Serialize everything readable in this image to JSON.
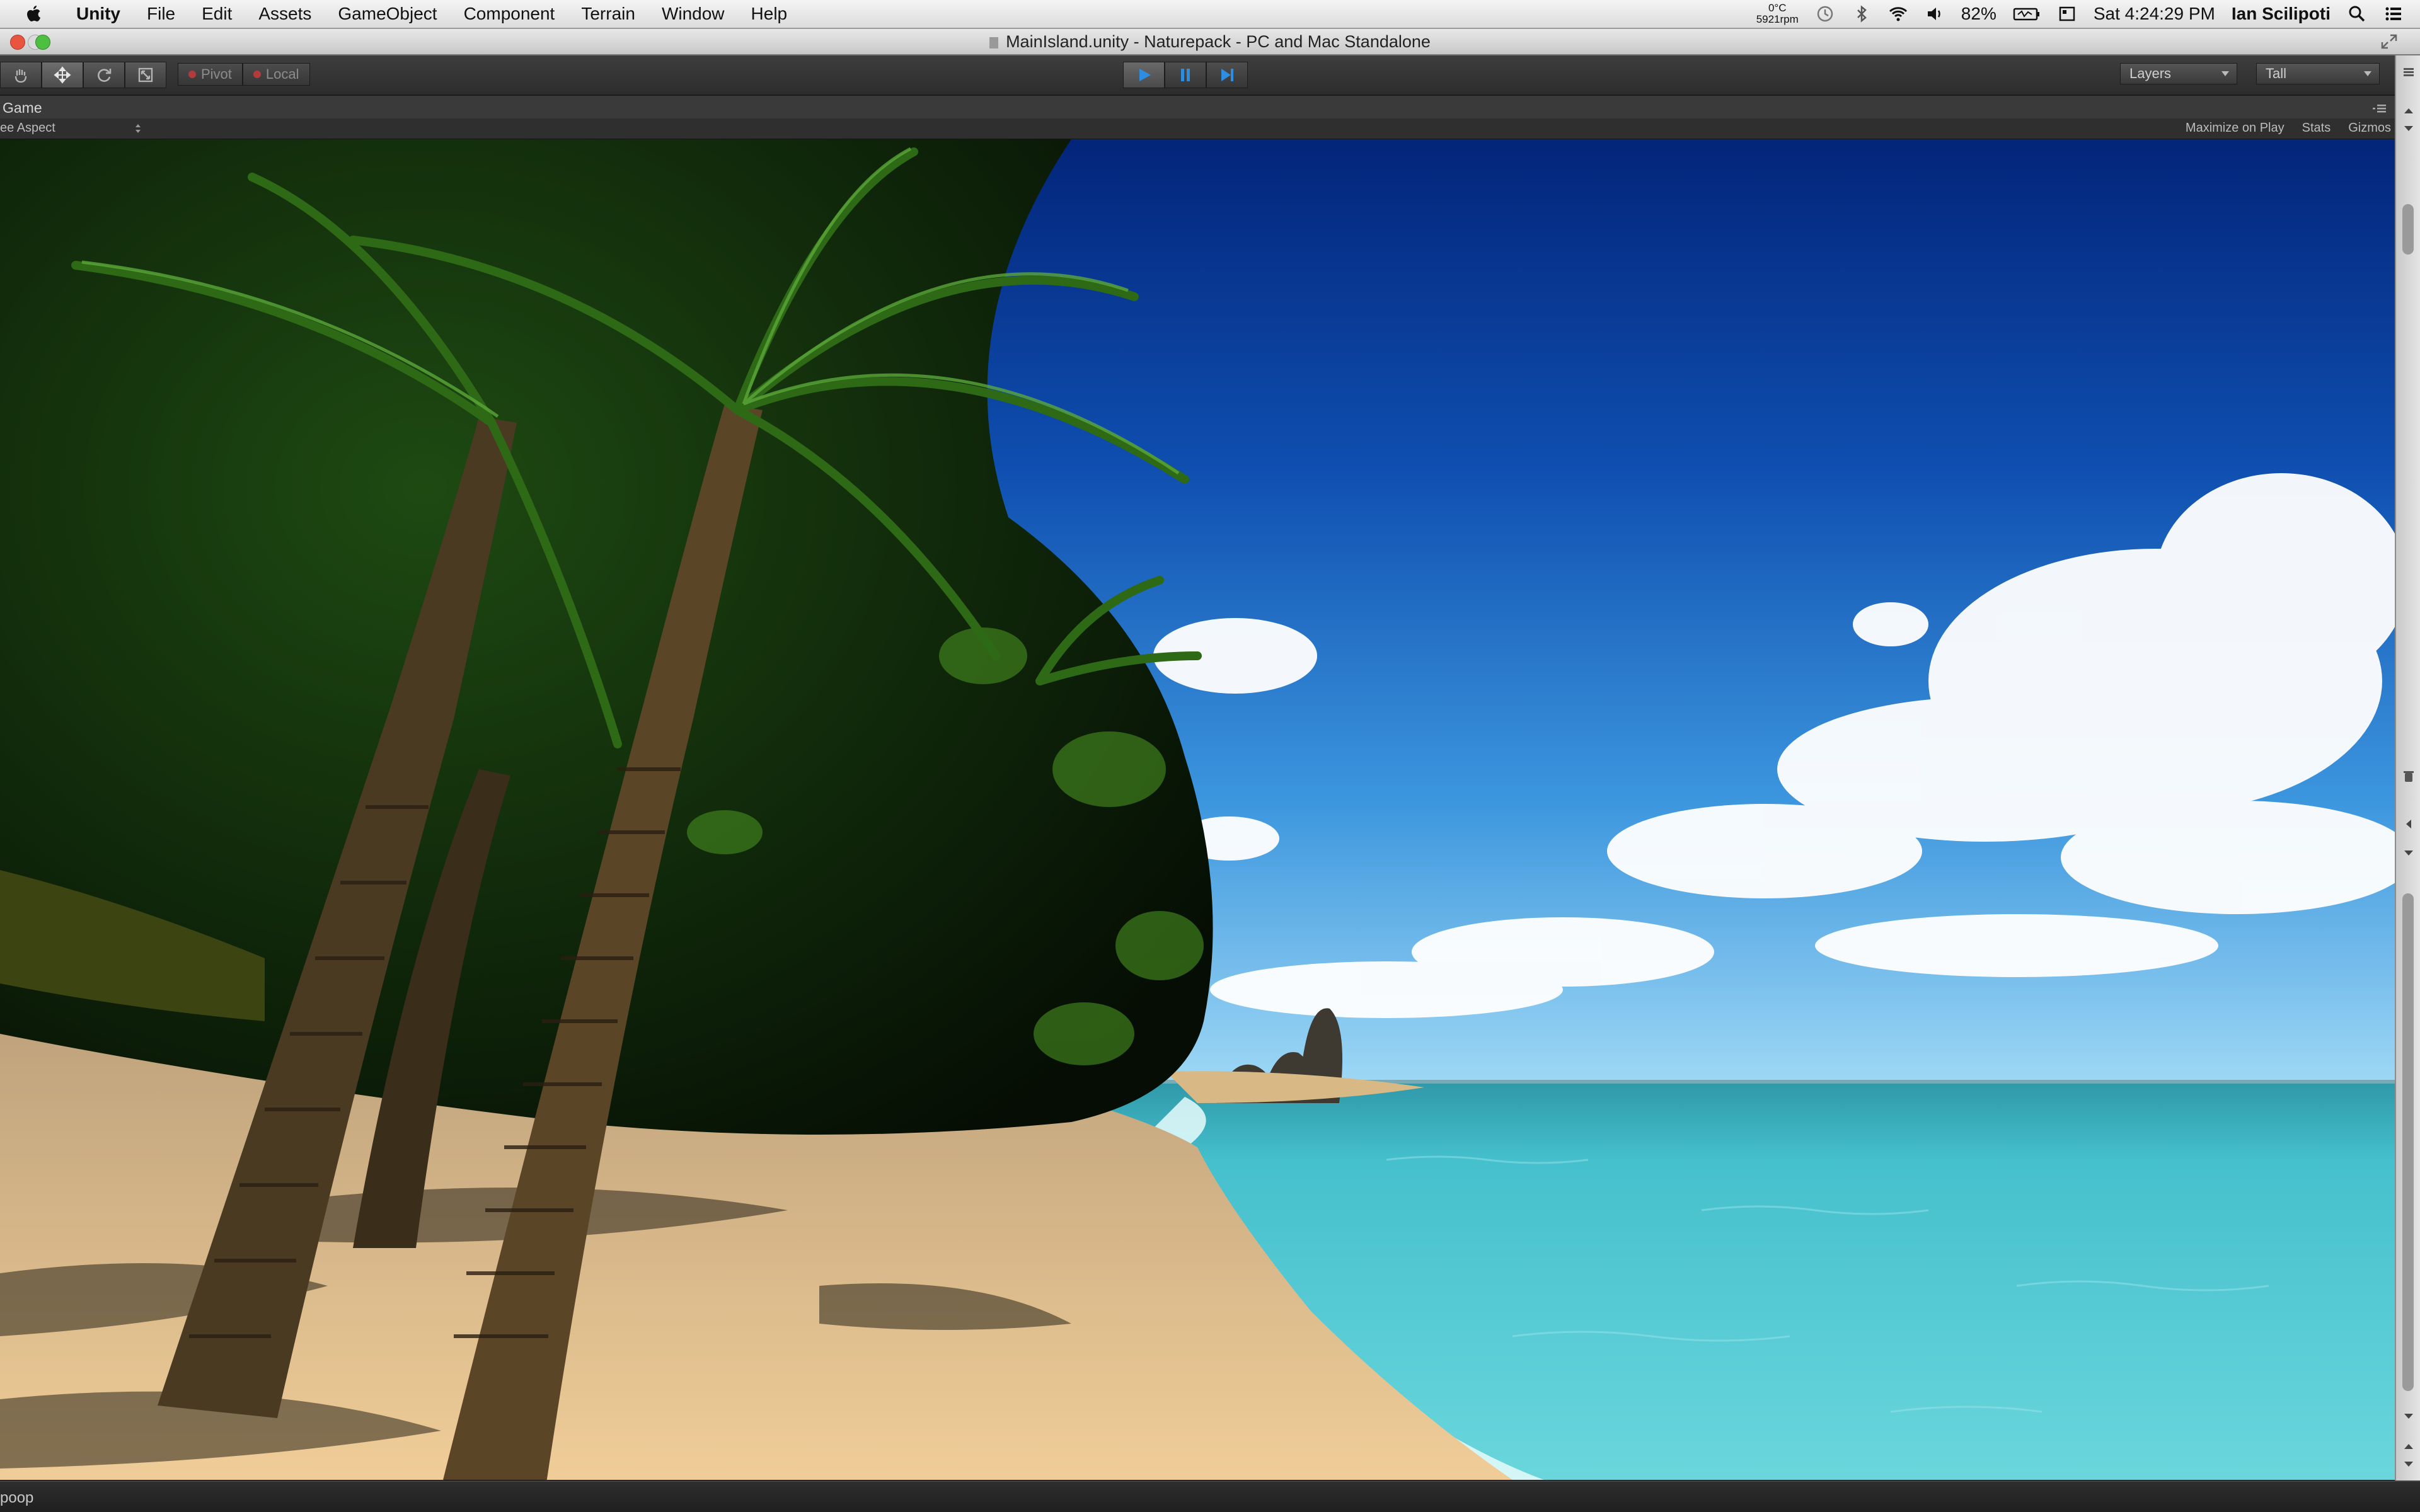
{
  "menubar": {
    "app_name": "Unity",
    "items": [
      "File",
      "Edit",
      "Assets",
      "GameObject",
      "Component",
      "Terrain",
      "Window",
      "Help"
    ],
    "status": {
      "temperature": "0°C",
      "fan_speed": "5921rpm",
      "battery": "82%",
      "clock": "Sat 4:24:29 PM",
      "user": "Ian Scilipoti"
    }
  },
  "window": {
    "title": "MainIsland.unity - Naturepack - PC and Mac Standalone"
  },
  "toolbar": {
    "transform_tools": [
      "hand-icon",
      "move-icon",
      "rotate-icon",
      "scale-icon"
    ],
    "pivot_label": "Pivot",
    "local_label": "Local",
    "play_controls": [
      "play-icon",
      "pause-icon",
      "step-icon"
    ],
    "layers_label": "Layers",
    "layout_label": "Tall"
  },
  "game_view": {
    "tab_label": "Game",
    "aspect_label": "ee Aspect",
    "options": [
      "Maximize on Play",
      "Stats",
      "Gizmos"
    ]
  },
  "statusbar": {
    "message": "poop"
  },
  "colors": {
    "sky_top": "#0a2a78",
    "sky_horizon": "#6fc4f2",
    "sea": "#4fc8d4",
    "sand": "#e2bf8a",
    "foliage": "#0e2a0a",
    "unity_dark": "#383838",
    "play_blue": "#2e8de0"
  }
}
